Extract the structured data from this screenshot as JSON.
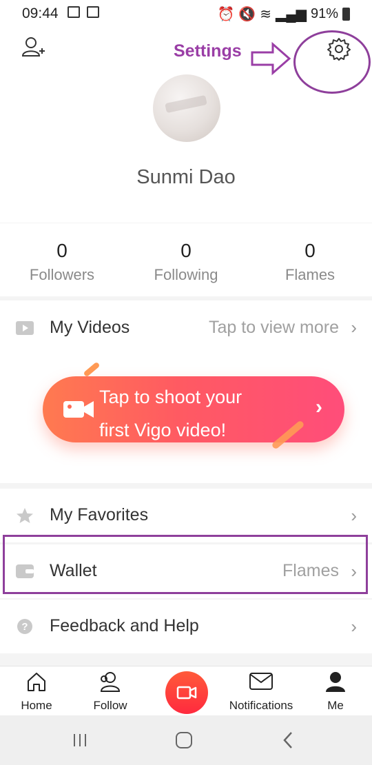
{
  "status_bar": {
    "time": "09:44",
    "battery": "91%"
  },
  "header": {
    "settings_annotation": "Settings",
    "username": "Sunmi Dao"
  },
  "stats": [
    {
      "value": "0",
      "label": "Followers"
    },
    {
      "value": "0",
      "label": "Following"
    },
    {
      "value": "0",
      "label": "Flames"
    }
  ],
  "videos": {
    "title": "My Videos",
    "more": "Tap to view more",
    "banner_line1": "Tap to shoot your",
    "banner_line2": "first Vigo video!"
  },
  "menu": {
    "favorites": "My Favorites",
    "wallet": "Wallet",
    "wallet_right": "Flames",
    "feedback": "Feedback and Help"
  },
  "bottom_nav": {
    "home": "Home",
    "follow": "Follow",
    "notifications": "Notifications",
    "me": "Me"
  },
  "colors": {
    "accent": "#ff4d5a",
    "annotation": "#8e3f9b"
  }
}
